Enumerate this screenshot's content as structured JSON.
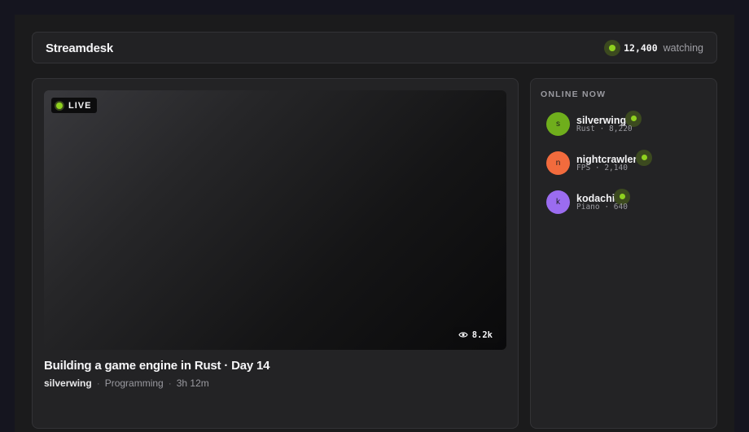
{
  "app": {
    "brand": "Streamdesk",
    "watching_count": "12,400",
    "watching_label": "watching"
  },
  "stream": {
    "live_label": "LIVE",
    "viewer_count": "8.2k",
    "title": "Building a game engine in Rust · Day 14",
    "streamer": "silverwing",
    "category": "Programming",
    "duration": "3h 12m",
    "separator": "·"
  },
  "sidebar": {
    "title": "ONLINE NOW",
    "users": [
      {
        "initial": "s",
        "name": "silverwing",
        "sub": "Rust · 8,220",
        "color": "#6fae1c"
      },
      {
        "initial": "n",
        "name": "nightcrawler",
        "sub": "FPS · 2,140",
        "color": "#f26b3d"
      },
      {
        "initial": "k",
        "name": "kodachi",
        "sub": "Piano · 640",
        "color": "#9b6cf0"
      }
    ]
  },
  "colors": {
    "accent": "#8fd11f",
    "background": "#15151f",
    "panel": "#232325"
  },
  "icons": [
    "live-dot-icon",
    "eye-icon",
    "online-dot-icon"
  ]
}
